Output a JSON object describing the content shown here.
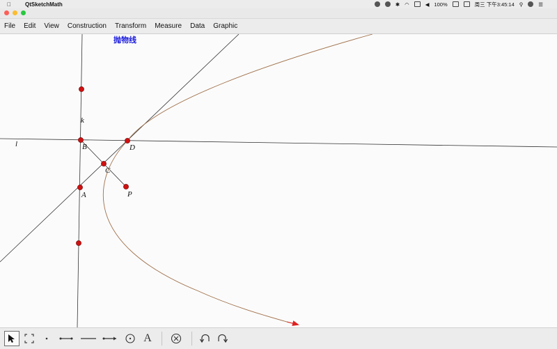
{
  "system_bar": {
    "apple": "",
    "app_name": "QtSketchMath",
    "battery": "100%",
    "clock": "周三 下午3:45:14"
  },
  "menu": [
    "File",
    "Edit",
    "View",
    "Construction",
    "Transform",
    "Measure",
    "Data",
    "Graphic"
  ],
  "canvas": {
    "title": "抛物线",
    "title_color": "#1a1adc",
    "labels": {
      "k": "k",
      "l": "l",
      "A": "A",
      "B": "B",
      "C": "C",
      "D": "D",
      "P": "P"
    },
    "point_color": "#d01010",
    "curve_color": "#a0704a"
  },
  "toolbar": {
    "tools": [
      "select-arrow-icon",
      "marquee-select-icon",
      "point-icon",
      "segment-icon",
      "line-icon",
      "ray-icon",
      "circle-icon",
      "text-icon",
      "delete-icon",
      "undo-icon",
      "redo-icon"
    ],
    "text_tool_glyph": "A"
  }
}
